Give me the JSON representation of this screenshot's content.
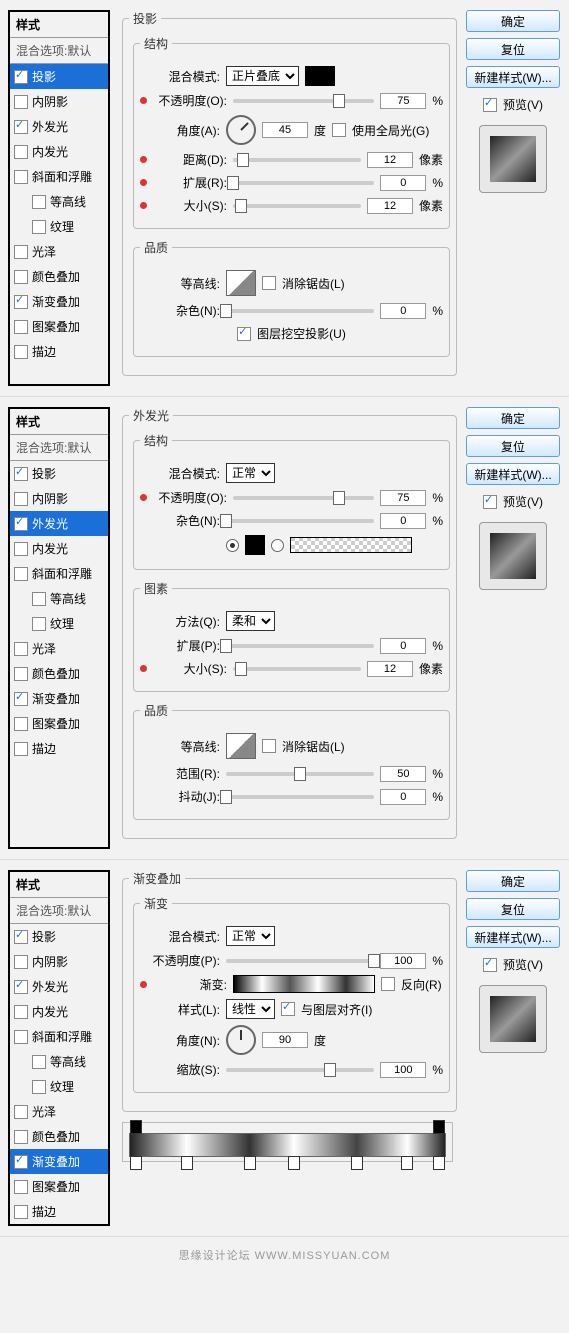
{
  "styleList": {
    "header": "样式",
    "subheader": "混合选项:默认",
    "items": [
      "投影",
      "内阴影",
      "外发光",
      "内发光",
      "斜面和浮雕",
      "等高线",
      "纹理",
      "光泽",
      "颜色叠加",
      "渐变叠加",
      "图案叠加",
      "描边"
    ]
  },
  "dlg1": {
    "title": "投影",
    "struct": "结构",
    "blendLbl": "混合模式:",
    "blendVal": "正片叠底",
    "opacityLbl": "不透明度(O):",
    "opacityVal": "75",
    "pct": "%",
    "angleLbl": "角度(A):",
    "angleVal": "45",
    "deg": "度",
    "globalLight": "使用全局光(G)",
    "distLbl": "距离(D):",
    "distVal": "12",
    "px": "像素",
    "spreadLbl": "扩展(R):",
    "spreadVal": "0",
    "sizeLbl": "大小(S):",
    "sizeVal": "12",
    "quality": "品质",
    "contourLbl": "等高线:",
    "antialias": "消除锯齿(L)",
    "noiseLbl": "杂色(N):",
    "noiseVal": "0",
    "knockout": "图层挖空投影(U)"
  },
  "dlg2": {
    "title": "外发光",
    "struct": "结构",
    "blendLbl": "混合模式:",
    "blendVal": "正常",
    "opacityLbl": "不透明度(O):",
    "opacityVal": "75",
    "pct": "%",
    "noiseLbl": "杂色(N):",
    "noiseVal": "0",
    "elements": "图素",
    "methodLbl": "方法(Q):",
    "methodVal": "柔和",
    "spreadLbl": "扩展(P):",
    "spreadVal": "0",
    "sizeLbl": "大小(S):",
    "sizeVal": "12",
    "px": "像素",
    "quality": "品质",
    "contourLbl": "等高线:",
    "antialias": "消除锯齿(L)",
    "rangeLbl": "范围(R):",
    "rangeVal": "50",
    "jitterLbl": "抖动(J):",
    "jitterVal": "0"
  },
  "dlg3": {
    "title": "渐变叠加",
    "grad": "渐变",
    "blendLbl": "混合模式:",
    "blendVal": "正常",
    "opacityLbl": "不透明度(P):",
    "opacityVal": "100",
    "pct": "%",
    "gradientLbl": "渐变:",
    "reverse": "反向(R)",
    "styleLbl": "样式(L):",
    "styleVal": "线性",
    "align": "与图层对齐(I)",
    "angleLbl": "角度(N):",
    "angleVal": "90",
    "deg": "度",
    "scaleLbl": "缩放(S):",
    "scaleVal": "100"
  },
  "buttons": {
    "ok": "确定",
    "reset": "复位",
    "newStyle": "新建样式(W)...",
    "preview": "预览(V)"
  },
  "footer": "思缘设计论坛   WWW.MISSYUAN.COM"
}
